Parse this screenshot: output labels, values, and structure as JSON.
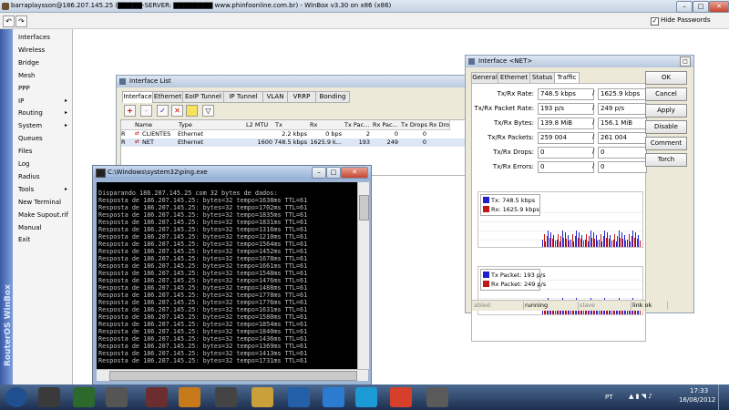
{
  "window": {
    "title": "barraplaysson@186.207.145.25 (▇▇▇▇▇-SERVER: ▇▇▇▇▇▇▇▇ www.phinfoonline.com.br) - WinBox v3.30 on x86 (x86)",
    "hide_passwords": "Hide Passwords"
  },
  "sidebar": {
    "brand": "RouterOS WinBox",
    "items": [
      {
        "label": "Interfaces",
        "arrow": ""
      },
      {
        "label": "Wireless",
        "arrow": ""
      },
      {
        "label": "Bridge",
        "arrow": ""
      },
      {
        "label": "Mesh",
        "arrow": ""
      },
      {
        "label": "PPP",
        "arrow": ""
      },
      {
        "label": "IP",
        "arrow": "▸"
      },
      {
        "label": "Routing",
        "arrow": "▸"
      },
      {
        "label": "System",
        "arrow": "▸"
      },
      {
        "label": "Queues",
        "arrow": ""
      },
      {
        "label": "Files",
        "arrow": ""
      },
      {
        "label": "Log",
        "arrow": ""
      },
      {
        "label": "Radius",
        "arrow": ""
      },
      {
        "label": "Tools",
        "arrow": "▸"
      },
      {
        "label": "New Terminal",
        "arrow": ""
      },
      {
        "label": "Make Supout.rif",
        "arrow": ""
      },
      {
        "label": "Manual",
        "arrow": ""
      },
      {
        "label": "Exit",
        "arrow": ""
      }
    ]
  },
  "interface_list": {
    "title": "Interface List",
    "tabs": [
      "Interface",
      "Ethernet",
      "EoIP Tunnel",
      "IP Tunnel",
      "VLAN",
      "VRRP",
      "Bonding"
    ],
    "columns": [
      "",
      "Name",
      "Type",
      "L2 MTU",
      "Tx",
      "Rx",
      "Tx Pac...",
      "Rx Pac...",
      "Tx Drops",
      "Rx Dro"
    ],
    "rows": [
      {
        "flag": "R",
        "name": "CLIENTES",
        "type": "Ethernet",
        "mtu": "",
        "tx": "2.2 kbps",
        "rx": "0 bps",
        "txp": "2",
        "rxp": "0",
        "txd": "0",
        "rxd": ""
      },
      {
        "flag": "R",
        "name": "NET",
        "type": "Ethernet",
        "mtu": "1600",
        "tx": "748.5 kbps",
        "rx": "1625.9 k...",
        "txp": "193",
        "rxp": "249",
        "txd": "0",
        "rxd": ""
      }
    ]
  },
  "interface_net": {
    "title": "Interface <NET>",
    "tabs": [
      "General",
      "Ethernet",
      "Status",
      "Traffic"
    ],
    "buttons": [
      "OK",
      "Cancel",
      "Apply",
      "Disable",
      "Comment",
      "Torch"
    ],
    "fields": [
      {
        "label": "Tx/Rx Rate:",
        "tx": "748.5 kbps",
        "rx": "1625.9 kbps"
      },
      {
        "label": "Tx/Rx Packet Rate:",
        "tx": "193 p/s",
        "rx": "249 p/s"
      },
      {
        "label": "Tx/Rx Bytes:",
        "tx": "139.8 MiB",
        "rx": "156.1 MiB"
      },
      {
        "label": "Tx/Rx Packets:",
        "tx": "259 004",
        "rx": "261 004"
      },
      {
        "label": "Tx/Rx Drops:",
        "tx": "0",
        "rx": "0"
      },
      {
        "label": "Tx/Rx Errors:",
        "tx": "0",
        "rx": "0"
      }
    ],
    "legend1": {
      "tx": "Tx:  748.5 kbps",
      "rx": "Rx:  1625.9 kbps"
    },
    "legend2": {
      "tx": "Tx Packet:  193 p/s",
      "rx": "Rx Packet:  249 p/s"
    },
    "status": [
      "abled",
      "running",
      "slave",
      "link ok"
    ],
    "tx_color": "#1f1fd0",
    "rx_color": "#c01818"
  },
  "console": {
    "title": "C:\\Windows\\system32\\ping.exe",
    "lines": [
      "Disparando 186.207.145.25 com 32 bytes de dados:",
      "Resposta de 186.207.145.25: bytes=32 tempo=1638ms TTL=61",
      "Resposta de 186.207.145.25: bytes=32 tempo=1702ms TTL=61",
      "Resposta de 186.207.145.25: bytes=32 tempo=1835ms TTL=61",
      "Resposta de 186.207.145.25: bytes=32 tempo=1831ms TTL=61",
      "Resposta de 186.207.145.25: bytes=32 tempo=1316ms TTL=61",
      "Resposta de 186.207.145.25: bytes=32 tempo=1210ms TTL=61",
      "Resposta de 186.207.145.25: bytes=32 tempo=1564ms TTL=61",
      "Resposta de 186.207.145.25: bytes=32 tempo=1452ms TTL=61",
      "Resposta de 186.207.145.25: bytes=32 tempo=1678ms TTL=61",
      "Resposta de 186.207.145.25: bytes=32 tempo=1661ms TTL=61",
      "Resposta de 186.207.145.25: bytes=32 tempo=1548ms TTL=61",
      "Resposta de 186.207.145.25: bytes=32 tempo=1476ms TTL=61",
      "Resposta de 186.207.145.25: bytes=32 tempo=1488ms TTL=61",
      "Resposta de 186.207.145.25: bytes=32 tempo=1778ms TTL=61",
      "Resposta de 186.207.145.25: bytes=32 tempo=1776ms TTL=61",
      "Resposta de 186.207.145.25: bytes=32 tempo=1631ms TTL=61",
      "Resposta de 186.207.145.25: bytes=32 tempo=1580ms TTL=61",
      "Resposta de 186.207.145.25: bytes=32 tempo=1854ms TTL=61",
      "Resposta de 186.207.145.25: bytes=32 tempo=1840ms TTL=61",
      "Resposta de 186.207.145.25: bytes=32 tempo=1436ms TTL=61",
      "Resposta de 186.207.145.25: bytes=32 tempo=1369ms TTL=61",
      "Resposta de 186.207.145.25: bytes=32 tempo=1413ms TTL=61",
      "Resposta de 186.207.145.25: bytes=32 tempo=1731ms TTL=61"
    ]
  },
  "taskbar": {
    "apps": [
      "start-orb",
      "user-avatar",
      "nfs-game",
      "tire-app",
      "ssrd-app",
      "media-player",
      "mw-game",
      "file-explorer",
      "network-app",
      "internet-explorer",
      "skype",
      "chrome",
      "vmware"
    ],
    "lang": "PT",
    "time": "17:33",
    "date": "16/08/2012"
  }
}
